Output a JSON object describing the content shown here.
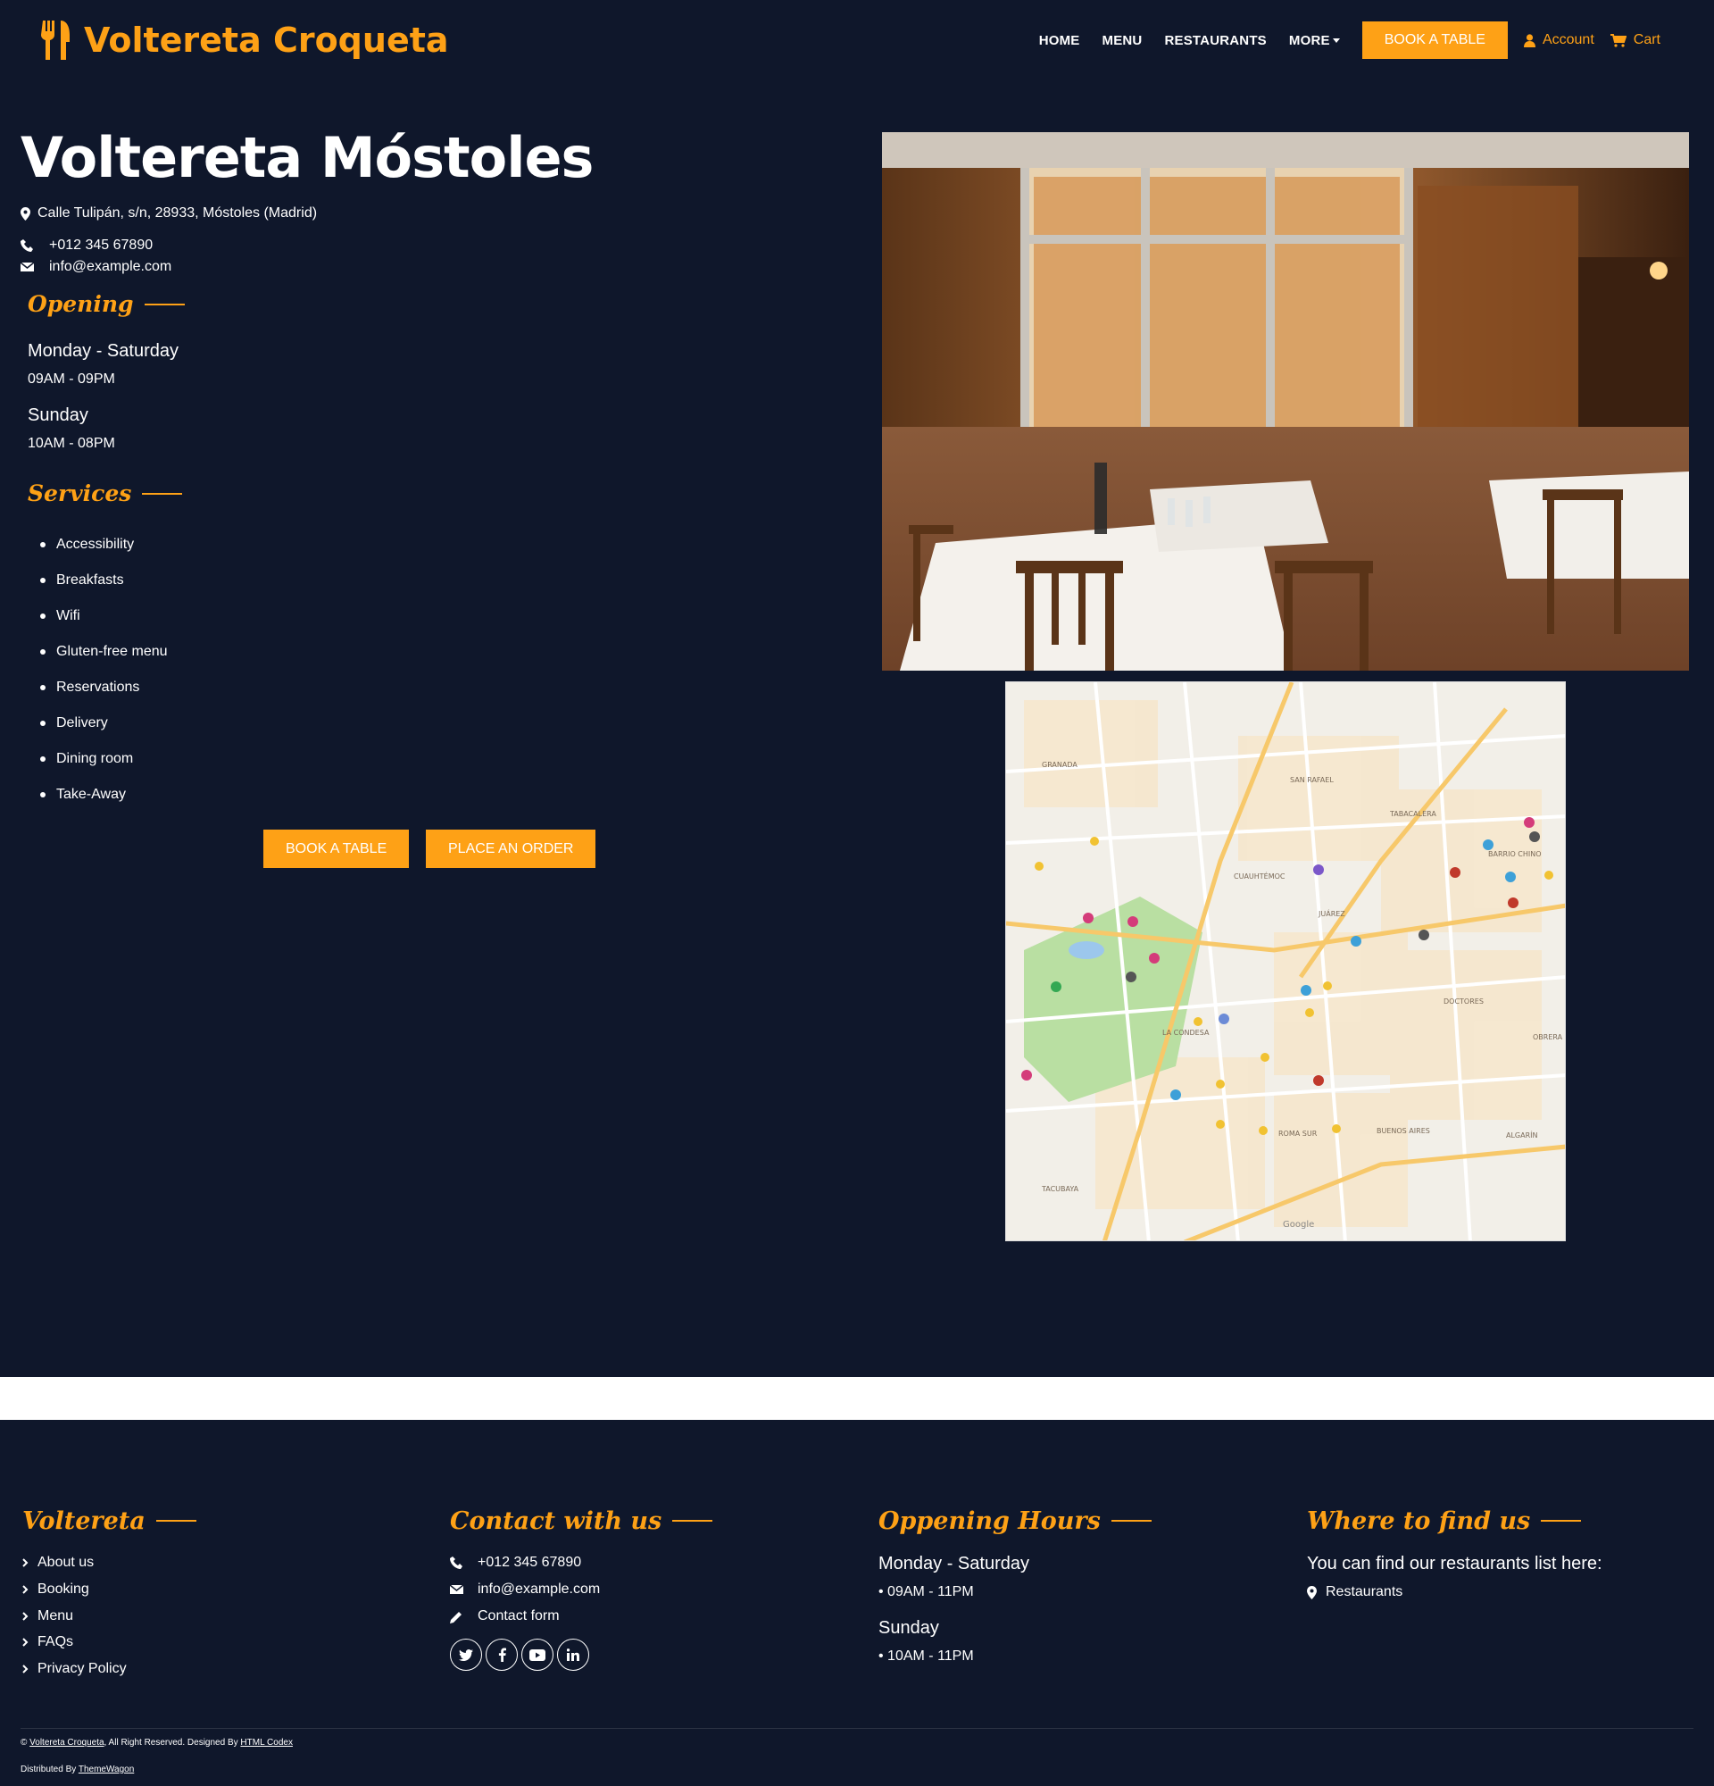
{
  "brand": {
    "name": "Voltereta Croqueta",
    "icon": "utensils-icon"
  },
  "nav": {
    "home": "HOME",
    "menu": "MENU",
    "restaurants": "RESTAURANTS",
    "more": "MORE",
    "book": "BOOK A TABLE",
    "account": "Account",
    "cart": "Cart"
  },
  "restaurant": {
    "title": "Voltereta Móstoles",
    "address": "Calle Tulipán, s/n, 28933, Móstoles (Madrid)",
    "phone": "+012 345 67890",
    "email": "info@example.com"
  },
  "opening": {
    "title": "Opening",
    "rows": [
      {
        "day": "Monday - Saturday",
        "hours": "09AM - 09PM"
      },
      {
        "day": "Sunday",
        "hours": "10AM - 08PM"
      }
    ]
  },
  "services": {
    "title": "Services",
    "items": [
      "Accessibility",
      "Breakfasts",
      "Wifi",
      "Gluten-free menu",
      "Reservations",
      "Delivery",
      "Dining room",
      "Take-Away"
    ]
  },
  "actions": {
    "book": "BOOK A TABLE",
    "order": "PLACE AN ORDER"
  },
  "map_labels": {
    "granada": "GRANADA",
    "san_rafael": "SAN RAFAEL",
    "tabacalera": "TABACALERA",
    "cuauhtemoc": "CUAUHTÉMOC",
    "juarez": "JUÁREZ",
    "doctores": "DOCTORES",
    "la_condesa": "LA CONDESA",
    "roma_sur": "ROMA SUR",
    "buenos_aires": "BUENOS AIRES",
    "algarin": "ALGARÍN",
    "barrio_chino": "BARRIO CHINO",
    "obrera": "OBRERA",
    "tacubaya": "TACUBAYA",
    "google": "Google"
  },
  "footer": {
    "col1": {
      "title": "Voltereta",
      "links": [
        "About us",
        "Booking",
        "Menu",
        "FAQs",
        "Privacy Policy"
      ]
    },
    "col2": {
      "title": "Contact with us",
      "phone": "+012 345 67890",
      "email": "info@example.com",
      "form": "Contact form"
    },
    "col3": {
      "title": "Oppening Hours",
      "rows": [
        {
          "day": "Monday - Saturday",
          "hours": "• 09AM - 11PM"
        },
        {
          "day": "Sunday",
          "hours": "• 10AM - 11PM"
        }
      ]
    },
    "col4": {
      "title": "Where to find us",
      "text": "You can find our restaurants list here:",
      "link": "Restaurants"
    },
    "copyright": {
      "prefix": "© ",
      "brand": "Voltereta Croqueta",
      "middle": ", All Right Reserved. Designed By ",
      "designer": "HTML Codex",
      "dist_prefix": "Distributed By ",
      "distributor": "ThemeWagon"
    }
  },
  "colors": {
    "background": "#0f172b",
    "accent": "#fea116",
    "text": "#ffffff"
  }
}
